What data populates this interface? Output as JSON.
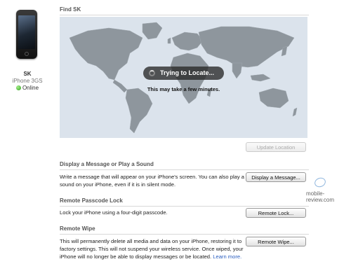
{
  "device": {
    "name": "SK",
    "model": "iPhone 3GS",
    "status": "Online"
  },
  "find": {
    "title": "Find SK",
    "locating_label": "Trying to Locate...",
    "locating_sub": "This may take a few minutes.",
    "update_button": "Update Location"
  },
  "message": {
    "title": "Display a Message or Play a Sound",
    "text_line1": "Write a message that will appear on your iPhone's screen. You can also play a",
    "text_line2": "sound on your iPhone, even if it is in silent mode.",
    "button": "Display a Message..."
  },
  "lock": {
    "title": "Remote Passcode Lock",
    "text": "Lock your iPhone using a four-digit passcode.",
    "button": "Remote Lock..."
  },
  "wipe": {
    "title": "Remote Wipe",
    "text_line1": "This will permanently delete all media and data on your iPhone, restoring it to",
    "text_line2": "factory settings. This will not suspend your wireless service. Once wiped, your",
    "text_line3": "iPhone will no longer be able to display messages or be located.",
    "learn_more": "Learn more.",
    "button": "Remote Wipe..."
  },
  "watermark": "mobile-review.com",
  "colors": {
    "map_water": "#dbe3ec",
    "map_land": "#8e969d",
    "status_online": "#2e9f1e",
    "link": "#2b5fc0"
  }
}
